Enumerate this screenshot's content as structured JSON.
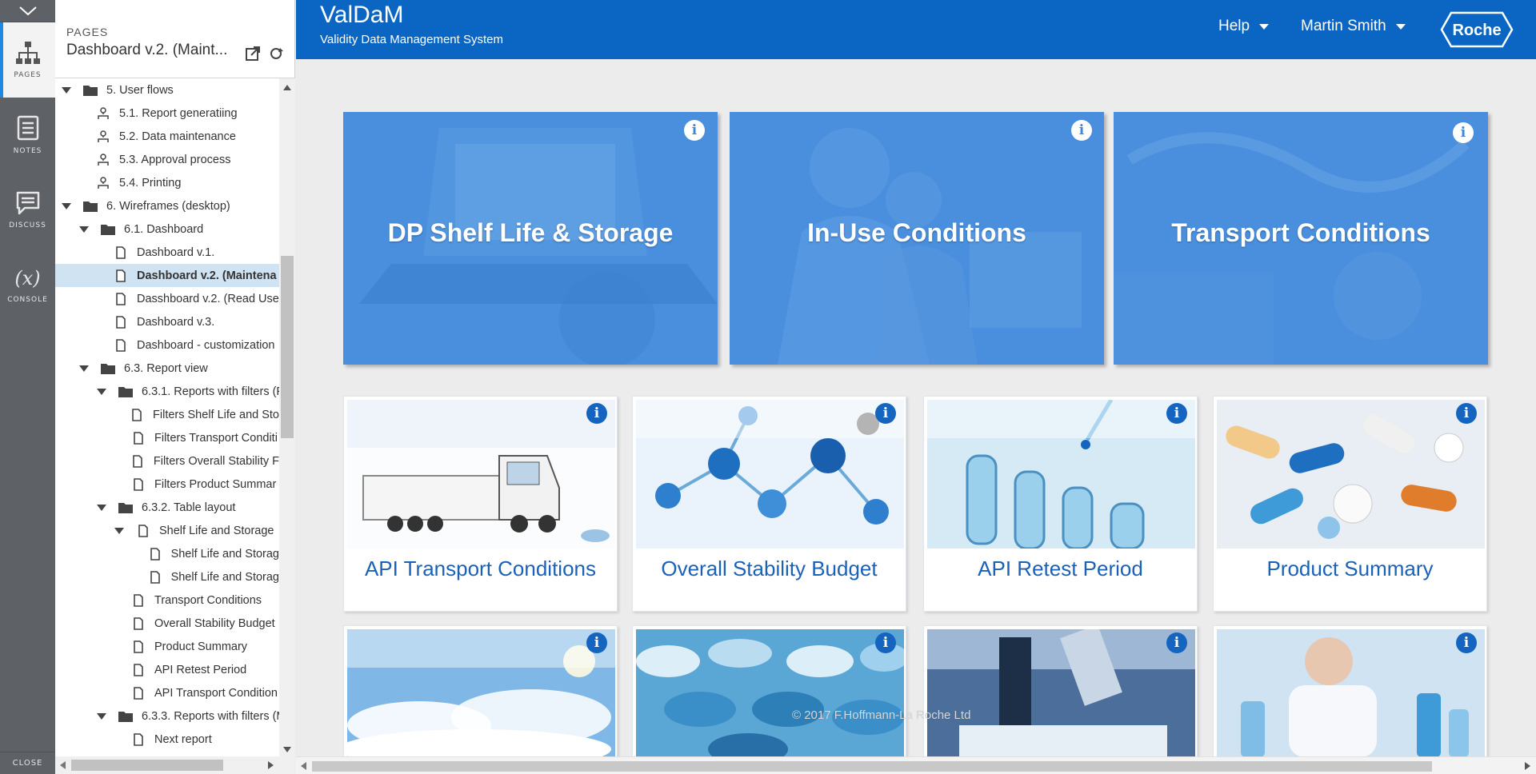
{
  "rail": {
    "items": [
      {
        "label": "PAGES",
        "icon": "sitemap-icon",
        "active": true
      },
      {
        "label": "NOTES",
        "icon": "notes-icon",
        "active": false
      },
      {
        "label": "DISCUSS",
        "icon": "discuss-icon",
        "active": false
      },
      {
        "label": "CONSOLE",
        "icon": "console-icon",
        "symbol": "(x)",
        "active": false
      }
    ],
    "close_label": "CLOSE"
  },
  "pages_panel": {
    "caption": "PAGES",
    "current_page": "Dashboard v.2. (Maint...",
    "tree": [
      {
        "label": "5. User flows",
        "type": "folder",
        "depth": 0,
        "open": true
      },
      {
        "label": "5.1. Report generatiing",
        "type": "flow",
        "depth": 1
      },
      {
        "label": "5.2. Data maintenance",
        "type": "flow",
        "depth": 1
      },
      {
        "label": "5.3. Approval process",
        "type": "flow",
        "depth": 1
      },
      {
        "label": "5.4. Printing",
        "type": "flow",
        "depth": 1
      },
      {
        "label": "6. Wireframes (desktop)",
        "type": "folder",
        "depth": 0,
        "open": true
      },
      {
        "label": "6.1. Dashboard",
        "type": "folder",
        "depth": 1,
        "open": true
      },
      {
        "label": "Dashboard v.1.",
        "type": "page",
        "depth": 2
      },
      {
        "label": "Dashboard v.2. (Maintena",
        "type": "page",
        "depth": 2,
        "selected": true
      },
      {
        "label": "Dasshboard v.2. (Read Use",
        "type": "page",
        "depth": 2
      },
      {
        "label": "Dashboard v.3.",
        "type": "page",
        "depth": 2
      },
      {
        "label": "Dashboard - customization",
        "type": "page",
        "depth": 2
      },
      {
        "label": "6.3. Report view",
        "type": "folder",
        "depth": 1,
        "open": true
      },
      {
        "label": "6.3.1. Reports with filters (F",
        "type": "folder",
        "depth": 2,
        "open": true
      },
      {
        "label": "Filters Shelf Life and Sto",
        "type": "page",
        "depth": 3
      },
      {
        "label": "Filters Transport Conditi",
        "type": "page",
        "depth": 3
      },
      {
        "label": "Filters Overall Stability F",
        "type": "page",
        "depth": 3
      },
      {
        "label": "Filters Product Summar",
        "type": "page",
        "depth": 3
      },
      {
        "label": "6.3.2. Table layout",
        "type": "folder",
        "depth": 2,
        "open": true
      },
      {
        "label": "Shelf Life and Storage",
        "type": "page",
        "depth": 3,
        "open": true
      },
      {
        "label": "Shelf Life and Storag",
        "type": "page",
        "depth": 4
      },
      {
        "label": "Shelf Life and Storag",
        "type": "page",
        "depth": 4
      },
      {
        "label": "Transport Conditions",
        "type": "page",
        "depth": 3
      },
      {
        "label": "Overall Stability Budget",
        "type": "page",
        "depth": 3
      },
      {
        "label": "Product Summary",
        "type": "page",
        "depth": 3
      },
      {
        "label": "API Retest Period",
        "type": "page",
        "depth": 3
      },
      {
        "label": "API Transport Condition",
        "type": "page",
        "depth": 3
      },
      {
        "label": "6.3.3. Reports with filters (M",
        "type": "folder",
        "depth": 2,
        "open": true
      },
      {
        "label": "Next report",
        "type": "page",
        "depth": 3
      },
      {
        "label": "",
        "type": "page",
        "depth": 3
      }
    ]
  },
  "header": {
    "app_name": "ValDaM",
    "app_subtitle": "Validity Data Management System",
    "help_label": "Help",
    "user_label": "Martin Smith",
    "logo_text": "Roche",
    "brand_color": "#0b66c3"
  },
  "big_tiles": [
    {
      "title": "DP Shelf Life & Storage"
    },
    {
      "title": "In-Use Conditions"
    },
    {
      "title": "Transport Conditions"
    }
  ],
  "cards": [
    {
      "title": "API Transport Conditions",
      "image": "truck"
    },
    {
      "title": "Overall Stability Budget",
      "image": "molecules"
    },
    {
      "title": "API Retest Period",
      "image": "test-tubes"
    },
    {
      "title": "Product Summary",
      "image": "pills"
    },
    {
      "title": "",
      "image": "sky"
    },
    {
      "title": "",
      "image": "blue-tablets"
    },
    {
      "title": "",
      "image": "microscope"
    },
    {
      "title": "",
      "image": "lab"
    }
  ],
  "footer": {
    "copyright": "© 2017 F.Hoffmann-La Roche Ltd"
  }
}
